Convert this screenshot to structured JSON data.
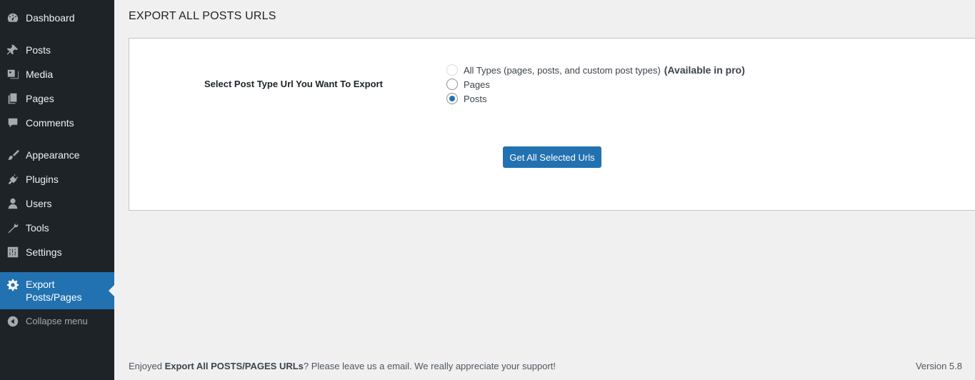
{
  "sidebar": {
    "items": [
      {
        "label": "Dashboard",
        "icon": "dashboard-icon"
      },
      {
        "label": "Posts",
        "icon": "pin-icon"
      },
      {
        "label": "Media",
        "icon": "media-icon"
      },
      {
        "label": "Pages",
        "icon": "pages-icon"
      },
      {
        "label": "Comments",
        "icon": "comment-icon"
      },
      {
        "label": "Appearance",
        "icon": "brush-icon"
      },
      {
        "label": "Plugins",
        "icon": "plugin-icon"
      },
      {
        "label": "Users",
        "icon": "user-icon"
      },
      {
        "label": "Tools",
        "icon": "wrench-icon"
      },
      {
        "label": "Settings",
        "icon": "settings-icon"
      }
    ],
    "current": {
      "line1": "Export",
      "line2": "Posts/Pages",
      "icon": "gear-icon"
    },
    "collapse": {
      "label": "Collapse menu",
      "icon": "collapse-icon"
    }
  },
  "main": {
    "title": "EXPORT ALL POSTS URLS",
    "field_label": "Select Post Type Url You Want To Export",
    "options": [
      {
        "label": "All Types (pages, posts, and custom post types)",
        "note": "(Available in pro)",
        "disabled": true,
        "checked": false
      },
      {
        "label": "Pages",
        "disabled": false,
        "checked": false
      },
      {
        "label": "Posts",
        "disabled": false,
        "checked": true
      }
    ],
    "submit_label": "Get All Selected Urls"
  },
  "footer": {
    "prefix": "Enjoyed ",
    "plugin_name": "Export All POSTS/PAGES URLs",
    "suffix": "? Please leave us a email. We really appreciate your support!",
    "version": "Version 5.8"
  },
  "colors": {
    "sidebar_bg": "#1d2327",
    "accent": "#2271b1",
    "page_bg": "#f0f0f1"
  }
}
